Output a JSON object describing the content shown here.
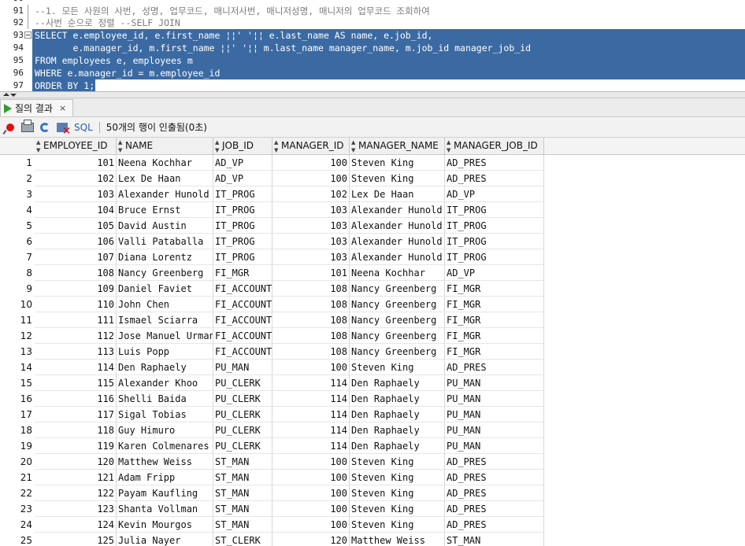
{
  "editor": {
    "lines": [
      {
        "no": "90",
        "text": ""
      },
      {
        "no": "91",
        "text": "--1. 모든 사원의 사번, 성명, 업무코드, 매니저사번, 매니저성명, 매니저의 업무코드 조회하여"
      },
      {
        "no": "92",
        "text": "--사번 순으로 정렬 --SELF JOIN"
      },
      {
        "no": "93",
        "text": "SELECT e.employee_id, e.first_name ¦¦' '¦¦ e.last_name AS name, e.job_id,"
      },
      {
        "no": "94",
        "text": "       e.manager_id, m.first_name ¦¦' '¦¦ m.last_name manager_name, m.job_id manager_job_id"
      },
      {
        "no": "95",
        "text": "FROM employees e, employees m"
      },
      {
        "no": "96",
        "text": "WHERE e.manager_id = m.employee_id"
      },
      {
        "no": "97",
        "text": "ORDER BY 1;"
      }
    ]
  },
  "results_tab": {
    "label": "질의 결과",
    "close": "×"
  },
  "toolbar": {
    "sql_label": "SQL",
    "status": "50개의 행이 인출됨(0초)"
  },
  "grid": {
    "columns": [
      "EMPLOYEE_ID",
      "NAME",
      "JOB_ID",
      "MANAGER_ID",
      "MANAGER_NAME",
      "MANAGER_JOB_ID"
    ],
    "rows": [
      [
        "1",
        "101",
        "Neena Kochhar",
        "AD_VP",
        "100",
        "Steven King",
        "AD_PRES"
      ],
      [
        "2",
        "102",
        "Lex De Haan",
        "AD_VP",
        "100",
        "Steven King",
        "AD_PRES"
      ],
      [
        "3",
        "103",
        "Alexander Hunold",
        "IT_PROG",
        "102",
        "Lex De Haan",
        "AD_VP"
      ],
      [
        "4",
        "104",
        "Bruce Ernst",
        "IT_PROG",
        "103",
        "Alexander Hunold",
        "IT_PROG"
      ],
      [
        "5",
        "105",
        "David Austin",
        "IT_PROG",
        "103",
        "Alexander Hunold",
        "IT_PROG"
      ],
      [
        "6",
        "106",
        "Valli Pataballa",
        "IT_PROG",
        "103",
        "Alexander Hunold",
        "IT_PROG"
      ],
      [
        "7",
        "107",
        "Diana Lorentz",
        "IT_PROG",
        "103",
        "Alexander Hunold",
        "IT_PROG"
      ],
      [
        "8",
        "108",
        "Nancy Greenberg",
        "FI_MGR",
        "101",
        "Neena Kochhar",
        "AD_VP"
      ],
      [
        "9",
        "109",
        "Daniel Faviet",
        "FI_ACCOUNT",
        "108",
        "Nancy Greenberg",
        "FI_MGR"
      ],
      [
        "10",
        "110",
        "John Chen",
        "FI_ACCOUNT",
        "108",
        "Nancy Greenberg",
        "FI_MGR"
      ],
      [
        "11",
        "111",
        "Ismael Sciarra",
        "FI_ACCOUNT",
        "108",
        "Nancy Greenberg",
        "FI_MGR"
      ],
      [
        "12",
        "112",
        "Jose Manuel Urman",
        "FI_ACCOUNT",
        "108",
        "Nancy Greenberg",
        "FI_MGR"
      ],
      [
        "13",
        "113",
        "Luis Popp",
        "FI_ACCOUNT",
        "108",
        "Nancy Greenberg",
        "FI_MGR"
      ],
      [
        "14",
        "114",
        "Den Raphaely",
        "PU_MAN",
        "100",
        "Steven King",
        "AD_PRES"
      ],
      [
        "15",
        "115",
        "Alexander Khoo",
        "PU_CLERK",
        "114",
        "Den Raphaely",
        "PU_MAN"
      ],
      [
        "16",
        "116",
        "Shelli Baida",
        "PU_CLERK",
        "114",
        "Den Raphaely",
        "PU_MAN"
      ],
      [
        "17",
        "117",
        "Sigal Tobias",
        "PU_CLERK",
        "114",
        "Den Raphaely",
        "PU_MAN"
      ],
      [
        "18",
        "118",
        "Guy Himuro",
        "PU_CLERK",
        "114",
        "Den Raphaely",
        "PU_MAN"
      ],
      [
        "19",
        "119",
        "Karen Colmenares",
        "PU_CLERK",
        "114",
        "Den Raphaely",
        "PU_MAN"
      ],
      [
        "20",
        "120",
        "Matthew Weiss",
        "ST_MAN",
        "100",
        "Steven King",
        "AD_PRES"
      ],
      [
        "21",
        "121",
        "Adam Fripp",
        "ST_MAN",
        "100",
        "Steven King",
        "AD_PRES"
      ],
      [
        "22",
        "122",
        "Payam Kaufling",
        "ST_MAN",
        "100",
        "Steven King",
        "AD_PRES"
      ],
      [
        "23",
        "123",
        "Shanta Vollman",
        "ST_MAN",
        "100",
        "Steven King",
        "AD_PRES"
      ],
      [
        "24",
        "124",
        "Kevin Mourgos",
        "ST_MAN",
        "100",
        "Steven King",
        "AD_PRES"
      ],
      [
        "25",
        "125",
        "Julia Nayer",
        "ST_CLERK",
        "120",
        "Matthew Weiss",
        "ST_MAN"
      ]
    ]
  }
}
